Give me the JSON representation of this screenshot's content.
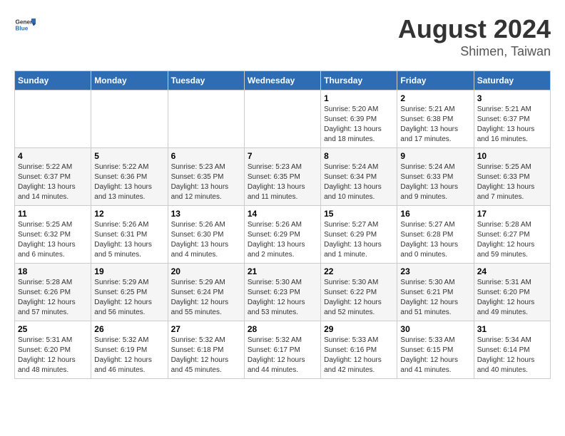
{
  "header": {
    "logo_general": "General",
    "logo_blue": "Blue",
    "main_title": "August 2024",
    "sub_title": "Shimen, Taiwan"
  },
  "days_of_week": [
    "Sunday",
    "Monday",
    "Tuesday",
    "Wednesday",
    "Thursday",
    "Friday",
    "Saturday"
  ],
  "weeks": [
    [
      {
        "day": "",
        "info": ""
      },
      {
        "day": "",
        "info": ""
      },
      {
        "day": "",
        "info": ""
      },
      {
        "day": "",
        "info": ""
      },
      {
        "day": "1",
        "info": "Sunrise: 5:20 AM\nSunset: 6:39 PM\nDaylight: 13 hours\nand 18 minutes."
      },
      {
        "day": "2",
        "info": "Sunrise: 5:21 AM\nSunset: 6:38 PM\nDaylight: 13 hours\nand 17 minutes."
      },
      {
        "day": "3",
        "info": "Sunrise: 5:21 AM\nSunset: 6:37 PM\nDaylight: 13 hours\nand 16 minutes."
      }
    ],
    [
      {
        "day": "4",
        "info": "Sunrise: 5:22 AM\nSunset: 6:37 PM\nDaylight: 13 hours\nand 14 minutes."
      },
      {
        "day": "5",
        "info": "Sunrise: 5:22 AM\nSunset: 6:36 PM\nDaylight: 13 hours\nand 13 minutes."
      },
      {
        "day": "6",
        "info": "Sunrise: 5:23 AM\nSunset: 6:35 PM\nDaylight: 13 hours\nand 12 minutes."
      },
      {
        "day": "7",
        "info": "Sunrise: 5:23 AM\nSunset: 6:35 PM\nDaylight: 13 hours\nand 11 minutes."
      },
      {
        "day": "8",
        "info": "Sunrise: 5:24 AM\nSunset: 6:34 PM\nDaylight: 13 hours\nand 10 minutes."
      },
      {
        "day": "9",
        "info": "Sunrise: 5:24 AM\nSunset: 6:33 PM\nDaylight: 13 hours\nand 9 minutes."
      },
      {
        "day": "10",
        "info": "Sunrise: 5:25 AM\nSunset: 6:33 PM\nDaylight: 13 hours\nand 7 minutes."
      }
    ],
    [
      {
        "day": "11",
        "info": "Sunrise: 5:25 AM\nSunset: 6:32 PM\nDaylight: 13 hours\nand 6 minutes."
      },
      {
        "day": "12",
        "info": "Sunrise: 5:26 AM\nSunset: 6:31 PM\nDaylight: 13 hours\nand 5 minutes."
      },
      {
        "day": "13",
        "info": "Sunrise: 5:26 AM\nSunset: 6:30 PM\nDaylight: 13 hours\nand 4 minutes."
      },
      {
        "day": "14",
        "info": "Sunrise: 5:26 AM\nSunset: 6:29 PM\nDaylight: 13 hours\nand 2 minutes."
      },
      {
        "day": "15",
        "info": "Sunrise: 5:27 AM\nSunset: 6:29 PM\nDaylight: 13 hours\nand 1 minute."
      },
      {
        "day": "16",
        "info": "Sunrise: 5:27 AM\nSunset: 6:28 PM\nDaylight: 13 hours\nand 0 minutes."
      },
      {
        "day": "17",
        "info": "Sunrise: 5:28 AM\nSunset: 6:27 PM\nDaylight: 12 hours\nand 59 minutes."
      }
    ],
    [
      {
        "day": "18",
        "info": "Sunrise: 5:28 AM\nSunset: 6:26 PM\nDaylight: 12 hours\nand 57 minutes."
      },
      {
        "day": "19",
        "info": "Sunrise: 5:29 AM\nSunset: 6:25 PM\nDaylight: 12 hours\nand 56 minutes."
      },
      {
        "day": "20",
        "info": "Sunrise: 5:29 AM\nSunset: 6:24 PM\nDaylight: 12 hours\nand 55 minutes."
      },
      {
        "day": "21",
        "info": "Sunrise: 5:30 AM\nSunset: 6:23 PM\nDaylight: 12 hours\nand 53 minutes."
      },
      {
        "day": "22",
        "info": "Sunrise: 5:30 AM\nSunset: 6:22 PM\nDaylight: 12 hours\nand 52 minutes."
      },
      {
        "day": "23",
        "info": "Sunrise: 5:30 AM\nSunset: 6:21 PM\nDaylight: 12 hours\nand 51 minutes."
      },
      {
        "day": "24",
        "info": "Sunrise: 5:31 AM\nSunset: 6:20 PM\nDaylight: 12 hours\nand 49 minutes."
      }
    ],
    [
      {
        "day": "25",
        "info": "Sunrise: 5:31 AM\nSunset: 6:20 PM\nDaylight: 12 hours\nand 48 minutes."
      },
      {
        "day": "26",
        "info": "Sunrise: 5:32 AM\nSunset: 6:19 PM\nDaylight: 12 hours\nand 46 minutes."
      },
      {
        "day": "27",
        "info": "Sunrise: 5:32 AM\nSunset: 6:18 PM\nDaylight: 12 hours\nand 45 minutes."
      },
      {
        "day": "28",
        "info": "Sunrise: 5:32 AM\nSunset: 6:17 PM\nDaylight: 12 hours\nand 44 minutes."
      },
      {
        "day": "29",
        "info": "Sunrise: 5:33 AM\nSunset: 6:16 PM\nDaylight: 12 hours\nand 42 minutes."
      },
      {
        "day": "30",
        "info": "Sunrise: 5:33 AM\nSunset: 6:15 PM\nDaylight: 12 hours\nand 41 minutes."
      },
      {
        "day": "31",
        "info": "Sunrise: 5:34 AM\nSunset: 6:14 PM\nDaylight: 12 hours\nand 40 minutes."
      }
    ]
  ]
}
